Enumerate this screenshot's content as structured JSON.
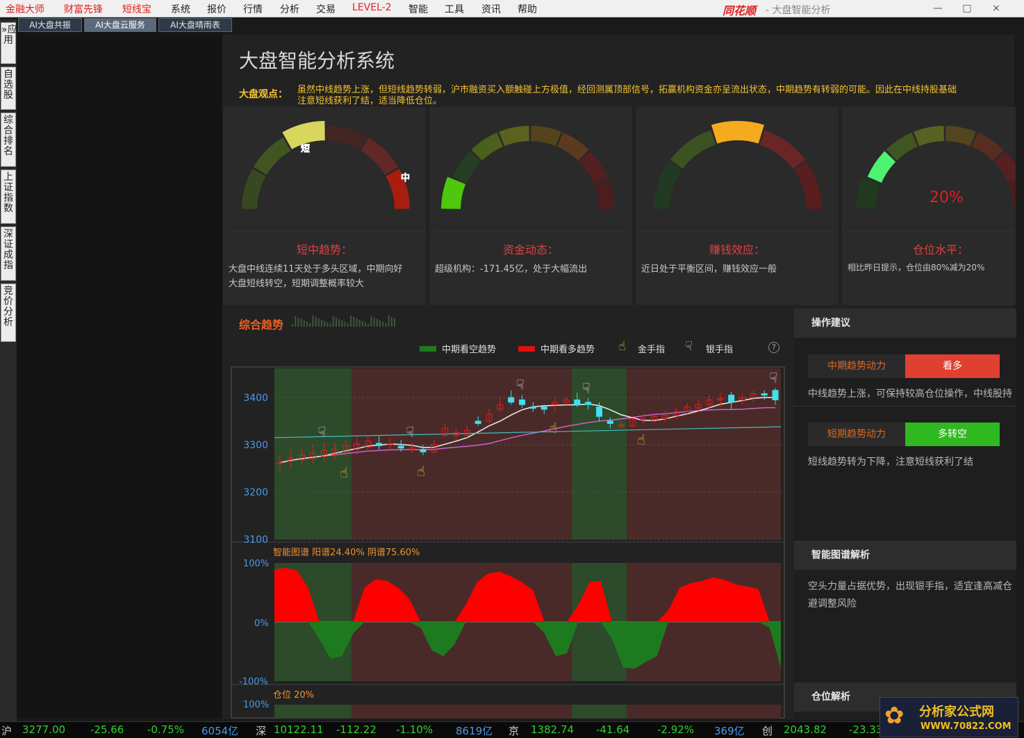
{
  "menu": {
    "items": [
      "金融大师",
      "财富先锋",
      "短线宝",
      "系统",
      "报价",
      "行情",
      "分析",
      "交易",
      "LEVEL-2",
      "智能",
      "工具",
      "资讯",
      "帮助"
    ],
    "red_items": [
      0,
      1,
      2,
      8
    ]
  },
  "brand": {
    "logo": "同花顺",
    "subtitle": "- 大盘智能分析"
  },
  "window_buttons": [
    "—",
    "□",
    "×"
  ],
  "sidebar": {
    "tabs": [
      "»应用",
      "自选股",
      "综合排名",
      "上证指数",
      "深证成指",
      "竞价分析"
    ]
  },
  "tabs": [
    "AI大盘共振",
    "AI大盘云服务",
    "AI大盘晴雨表"
  ],
  "active_tab": 1,
  "system_title": "大盘智能分析系统",
  "view": {
    "label": "大盘观点：",
    "lines": [
      "虽然中线趋势上涨，但短线趋势转弱，沪市融资买入额触碰上方极值，经回测属顶部信号，拓赢机构资金亦呈流出状态，中期趋势有转弱的可能。因此在中线持股基础",
      "注意短线获利了结，适当降低仓位。"
    ]
  },
  "gauges": [
    {
      "title": "短中趋势：",
      "desc": [
        "大盘中线连续11天处于多头区域，中期向好",
        "大盘短线转空，短期调整概率较大"
      ],
      "markers": [
        "短",
        "中"
      ],
      "highlight": [
        2,
        7
      ],
      "colors": [
        "#37491f",
        "#41561f",
        "#d6d75c",
        "#452424",
        "#642727",
        "#a81d0e"
      ]
    },
    {
      "title": "资金动态：",
      "desc": [
        "超级机构：-171.45亿，处于大幅流出"
      ],
      "highlight": [
        0
      ],
      "colors": [
        "#4dc80c",
        "#263f24",
        "#49611c",
        "#5b611f",
        "#55431d",
        "#5b3a1f",
        "#541f1f",
        "#4d1d1d"
      ]
    },
    {
      "title": "赚钱效应：",
      "desc": [
        "近日处于平衡区间，赚钱效应一般"
      ],
      "highlight": [
        2
      ],
      "colors": [
        "#223a22",
        "#3c5222",
        "#f5ab1e",
        "#6a2525",
        "#5a1d1d"
      ]
    },
    {
      "title": "仓位水平：",
      "desc": [
        "相比昨日提示，仓位由80%减为20%"
      ],
      "percent": "20%",
      "highlight": [
        0
      ],
      "colors": [
        "#1f3a1f",
        "#4ef270",
        "#3f5522",
        "#576222",
        "#53451f",
        "#582d1f",
        "#562020",
        "#4d1c1c"
      ]
    }
  ],
  "trend": {
    "title": "综合趋势"
  },
  "legend": {
    "bear": "中期看空趋势",
    "bull": "中期看多趋势",
    "gold": "金手指",
    "silver": "银手指",
    "help": "?"
  },
  "chart_data": {
    "type": "line",
    "ylim": [
      3100,
      3450
    ],
    "yticks": [
      3100,
      3200,
      3300,
      3400
    ],
    "candles": [
      [
        3260,
        3262,
        3280,
        3245
      ],
      [
        3265,
        3272,
        3290,
        3250
      ],
      [
        3268,
        3278,
        3292,
        3255
      ],
      [
        3270,
        3282,
        3300,
        3260
      ],
      [
        3275,
        3288,
        3305,
        3265
      ],
      [
        3280,
        3290,
        3305,
        3270
      ],
      [
        3285,
        3298,
        3310,
        3275
      ],
      [
        3290,
        3302,
        3315,
        3280
      ],
      [
        3295,
        3308,
        3320,
        3285
      ],
      [
        3303,
        3298,
        3318,
        3290
      ],
      [
        3300,
        3302,
        3315,
        3290
      ],
      [
        3297,
        3293,
        3310,
        3285
      ],
      [
        3290,
        3293,
        3305,
        3282
      ],
      [
        3290,
        3285,
        3300,
        3278
      ],
      [
        3285,
        3300,
        3310,
        3280
      ],
      [
        3320,
        3335,
        3345,
        3315
      ],
      [
        3320,
        3325,
        3335,
        3310
      ],
      [
        3320,
        3330,
        3340,
        3315
      ],
      [
        3350,
        3345,
        3360,
        3340
      ],
      [
        3350,
        3365,
        3375,
        3345
      ],
      [
        3375,
        3385,
        3400,
        3370
      ],
      [
        3400,
        3390,
        3415,
        3385
      ],
      [
        3395,
        3385,
        3405,
        3378
      ],
      [
        3380,
        3377,
        3390,
        3370
      ],
      [
        3380,
        3375,
        3385,
        3365
      ],
      [
        3385,
        3390,
        3398,
        3370
      ],
      [
        3390,
        3395,
        3402,
        3380
      ],
      [
        3395,
        3385,
        3410,
        3380
      ],
      [
        3390,
        3385,
        3398,
        3375
      ],
      [
        3380,
        3360,
        3390,
        3350
      ],
      [
        3350,
        3345,
        3358,
        3335
      ],
      [
        3342,
        3342,
        3350,
        3335
      ],
      [
        3340,
        3355,
        3362,
        3335
      ],
      [
        3355,
        3355,
        3365,
        3345
      ],
      [
        3350,
        3360,
        3368,
        3348
      ],
      [
        3355,
        3362,
        3372,
        3348
      ],
      [
        3362,
        3370,
        3378,
        3355
      ],
      [
        3370,
        3380,
        3388,
        3365
      ],
      [
        3378,
        3385,
        3395,
        3370
      ],
      [
        3385,
        3395,
        3405,
        3378
      ],
      [
        3395,
        3398,
        3410,
        3380
      ],
      [
        3405,
        3390,
        3412,
        3375
      ],
      [
        3395,
        3400,
        3408,
        3385
      ],
      [
        3400,
        3408,
        3415,
        3390
      ],
      [
        3408,
        3405,
        3415,
        3395
      ],
      [
        3415,
        3395,
        3420,
        3385
      ]
    ],
    "bull_bands": [
      [
        0,
        6
      ],
      [
        27,
        31
      ]
    ],
    "gold_fingers": [
      6,
      13,
      25,
      33
    ],
    "silver_fingers": [
      4,
      12,
      22,
      28,
      45
    ],
    "sub_title": "智能图谱 阳谱24.40% 阴谱75.60%",
    "sub_ticks": [
      "100%",
      "0%",
      "-100%"
    ],
    "pos_title": "仓位 20%",
    "pos_tick": "100%"
  },
  "right_panel": {
    "ops_title": "操作建议",
    "mid_label": "中期趋势动力",
    "mid_value": "看多",
    "mid_desc": "中线趋势上涨，可保持较高仓位操作，中线股持",
    "short_label": "短期趋势动力",
    "short_value": "多转空",
    "short_desc": "短线趋势转为下降，注意短线获利了结",
    "smart_title": "智能图谱解析",
    "smart_desc": [
      "空头力量占据优势，出现银手指，适宜逢高减仓",
      "避调整风险"
    ],
    "pos_title": "仓位解析"
  },
  "ticker": [
    {
      "t": "沪",
      "c": "#d0d0d0"
    },
    {
      "t": "3277.00",
      "c": "#30d030"
    },
    {
      "t": "-25.66",
      "c": "#30d030"
    },
    {
      "t": "-0.75%",
      "c": "#30d030"
    },
    {
      "t": "6054亿",
      "c": "#4a9ae8"
    },
    {
      "t": "深",
      "c": "#d0d0d0"
    },
    {
      "t": "10122.11",
      "c": "#30d030"
    },
    {
      "t": "-112.22",
      "c": "#30d030"
    },
    {
      "t": "-1.10%",
      "c": "#30d030"
    },
    {
      "t": "8619亿",
      "c": "#4a9ae8"
    },
    {
      "t": "京",
      "c": "#d0d0d0"
    },
    {
      "t": "1382.74",
      "c": "#30d030"
    },
    {
      "t": "-41.64",
      "c": "#30d030"
    },
    {
      "t": "-2.92%",
      "c": "#30d030"
    },
    {
      "t": "369亿",
      "c": "#4a9ae8"
    },
    {
      "t": "创",
      "c": "#d0d0d0"
    },
    {
      "t": "2043.82",
      "c": "#30d030"
    },
    {
      "t": "-23.33",
      "c": "#30d030"
    }
  ],
  "watermark": {
    "name": "分析家公式网",
    "url": "WWW.70822.COM"
  }
}
